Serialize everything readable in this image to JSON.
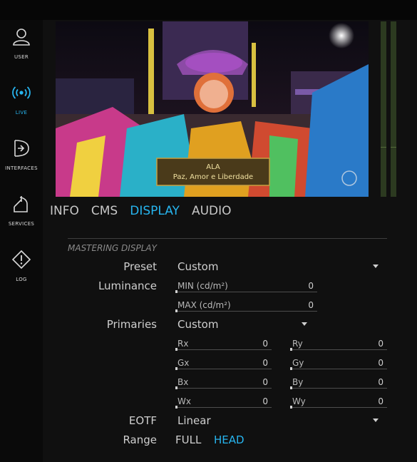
{
  "sidebar": {
    "items": [
      {
        "label": "USER",
        "icon": "user-icon"
      },
      {
        "label": "LIVE",
        "icon": "live-broadcast-icon",
        "active": true
      },
      {
        "label": "INTERFACES",
        "icon": "interfaces-icon"
      },
      {
        "label": "SERVICES",
        "icon": "services-icon"
      },
      {
        "label": "LOG",
        "icon": "log-warning-icon"
      }
    ]
  },
  "preview": {
    "caption_line1": "ALA",
    "caption_line2": "Paz, Amor e Liberdade"
  },
  "tabs": [
    {
      "label": "INFO"
    },
    {
      "label": "CMS"
    },
    {
      "label": "DISPLAY",
      "active": true
    },
    {
      "label": "AUDIO"
    }
  ],
  "mastering": {
    "title": "MASTERING DISPLAY",
    "preset_label": "Preset",
    "preset_value": "Custom",
    "luminance_label": "Luminance",
    "min_label": "MIN (cd/m²)",
    "min_value": "0",
    "max_label": "MAX (cd/m²)",
    "max_value": "0",
    "primaries_label": "Primaries",
    "primaries_value": "Custom",
    "rx_label": "Rx",
    "rx_value": "0",
    "ry_label": "Ry",
    "ry_value": "0",
    "gx_label": "Gx",
    "gx_value": "0",
    "gy_label": "Gy",
    "gy_value": "0",
    "bx_label": "Bx",
    "bx_value": "0",
    "by_label": "By",
    "by_value": "0",
    "wx_label": "Wx",
    "wx_value": "0",
    "wy_label": "Wy",
    "wy_value": "0",
    "eotf_label": "EOTF",
    "eotf_value": "Linear",
    "range_label": "Range",
    "range_full": "FULL",
    "range_head": "HEAD",
    "range_selected": "HEAD"
  },
  "colors": {
    "accent": "#27b5ef",
    "background": "#101010",
    "sidebar": "#0a0a0a",
    "text": "#cfcfcf"
  }
}
